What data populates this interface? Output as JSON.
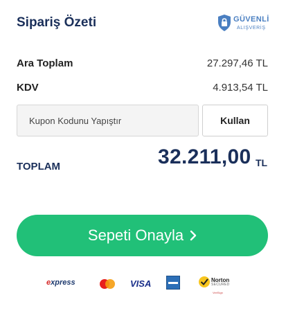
{
  "summary": {
    "title": "Sipariş Özeti",
    "secure_badge": {
      "line1": "GÜVENLİ",
      "line2": "ALIŞVERİŞ",
      "icon": "shield-lock-icon",
      "color": "#4a7fc1"
    },
    "subtotal": {
      "label": "Ara Toplam",
      "value": "27.297,46 TL"
    },
    "tax": {
      "label": "KDV",
      "value": "4.913,54 TL"
    },
    "coupon": {
      "placeholder": "Kupon Kodunu Yapıştır",
      "value": "",
      "apply_label": "Kullan"
    },
    "total": {
      "label": "TOPLAM",
      "value": "32.211,00",
      "currency": "TL"
    },
    "confirm": {
      "label": "Sepeti Onayla",
      "icon": "chevron-right-icon",
      "color": "#21c078"
    },
    "payments": {
      "express": {
        "prefix": "e",
        "text": "xpress"
      },
      "mastercard": {
        "icon": "mastercard-icon"
      },
      "visa": {
        "text": "VISA"
      },
      "amex": {
        "icon": "amex-icon"
      },
      "norton": {
        "name": "Norton",
        "sub": "SECURED",
        "foot": "VeriSign"
      }
    },
    "colors": {
      "heading": "#1a2f5a",
      "accent": "#21c078"
    }
  }
}
